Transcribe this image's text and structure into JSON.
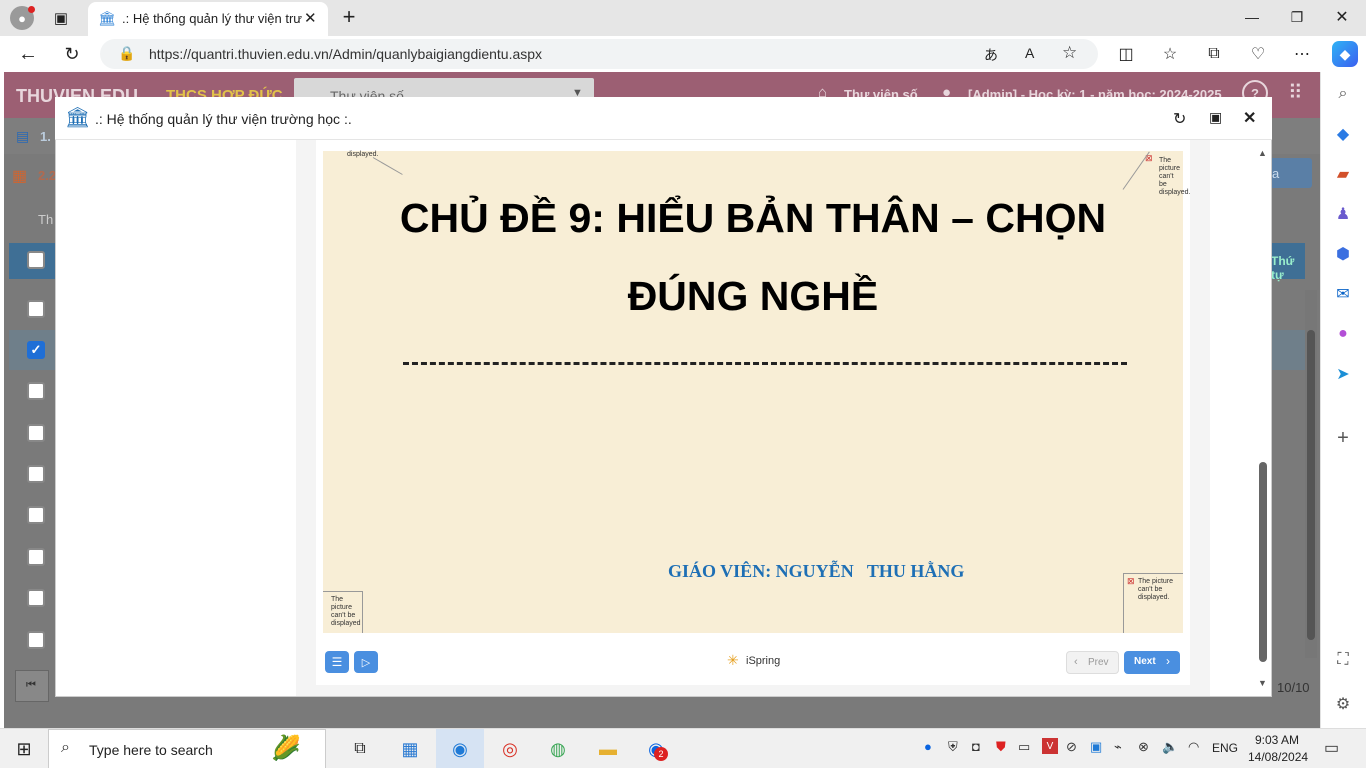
{
  "browser": {
    "tab_title": ".: Hệ thống quản lý thư viện trườ",
    "url": "https://quantri.thuvien.edu.vn/Admin/quanlybaigiangdientu.aspx"
  },
  "site": {
    "logo": "THUVIEN.EDU",
    "school": "THCS HỢP ĐỨC",
    "library_select": "Thư viện số",
    "home_link": "Thư viện số",
    "user_info": "[Admin] - Học kỳ: 1 - năm học: 2024-2025",
    "help": "?",
    "row1_label": "1.",
    "row2_label": "2.2",
    "search_hint": "Th",
    "button_partial": "a",
    "col_order": "Thứ tự",
    "pager": "10/10"
  },
  "modal": {
    "title": ".: Hệ thống quản lý thư viện trường học :."
  },
  "slide": {
    "title_line1": "CHỦ ĐỀ 9: HIỂU BẢN THÂN – CHỌN",
    "title_line2": "ĐÚNG NGHỀ",
    "teacher": "GIÁO VIÊN: NGUYỄN   THU HẰNG",
    "broken_img_top_left": "displayed.",
    "broken_img_top_right": "The picture can't be displayed.",
    "broken_img_bottom_left": "The picture can't be displayed",
    "broken_img_bottom_right": "The picture can't be displayed."
  },
  "player": {
    "brand": "iSpring",
    "prev": "Prev",
    "next": "Next"
  },
  "taskbar": {
    "search_placeholder": "Type here to search",
    "language": "ENG",
    "time": "9:03 AM",
    "date": "14/08/2024",
    "zalo_badge": "2"
  },
  "colors": {
    "site_header": "#9c5f73",
    "slide_bg": "#f8eed6",
    "title_text": "#000000",
    "teacher_text": "#1e6fb5",
    "next_button": "#4a8fe0",
    "checkbox_checked": "#1f6fd6"
  }
}
